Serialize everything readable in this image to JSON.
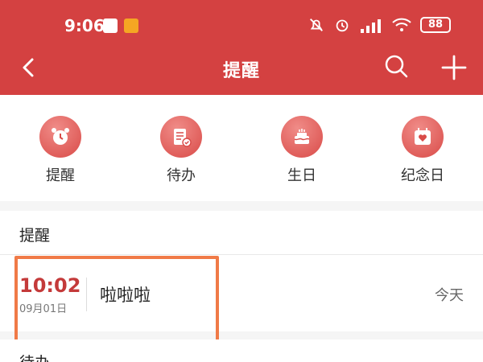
{
  "status_bar": {
    "time": "9:06",
    "battery": "88",
    "icons": [
      "app-icon-a",
      "app-icon-b",
      "bell-off-icon",
      "alarm-icon",
      "hd-signal-icon",
      "wifi-icon",
      "battery-icon"
    ]
  },
  "nav": {
    "title": "提醒",
    "back_icon": "back-arrow-icon",
    "search_icon": "search-icon",
    "add_icon": "plus-icon"
  },
  "categories": [
    {
      "label": "提醒",
      "icon": "alarm-clock-icon"
    },
    {
      "label": "待办",
      "icon": "todo-list-icon"
    },
    {
      "label": "生日",
      "icon": "birthday-cake-icon"
    },
    {
      "label": "纪念日",
      "icon": "heart-calendar-icon"
    }
  ],
  "reminder_section": {
    "title": "提醒",
    "items": [
      {
        "time": "10:02",
        "date": "09月01日",
        "text": "啦啦啦",
        "day": "今天"
      }
    ]
  },
  "todo_section": {
    "title": "待办"
  },
  "colors": {
    "header": "#d44141",
    "accent": "#c43a3a",
    "highlight": "#f07a47"
  }
}
